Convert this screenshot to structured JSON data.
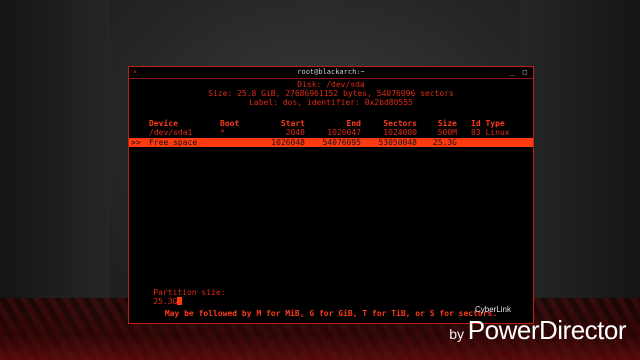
{
  "window": {
    "title": "root@blackarch:~",
    "close_glyph": "×",
    "controls": "_ □"
  },
  "disk": {
    "title": "Disk: /dev/sda",
    "size_line": "Size: 25.8 GiB, 27686961152 bytes, 54076096 sectors",
    "label_line": "Label: dos, identifier: 0x2bd80555"
  },
  "table": {
    "headers": [
      "Device",
      "Boot",
      "Start",
      "End",
      "Sectors",
      "Size",
      "Id Type"
    ],
    "rows": [
      {
        "marker": "",
        "device": "/dev/sda1",
        "boot": "*",
        "start": "2048",
        "end": "1026047",
        "sectors": "1024000",
        "size": "500M",
        "id_type": "83 Linux"
      },
      {
        "marker": ">>",
        "device": "Free space",
        "boot": "",
        "start": "1026048",
        "end": "54076095",
        "sectors": "53050048",
        "size": "25.3G",
        "id_type": ""
      }
    ]
  },
  "prompt": {
    "label": "Partition size:",
    "value": "25.3G"
  },
  "hint": "May be followed by M for MiB, G for GiB, T for TiB, or S for sectors.",
  "watermark": {
    "by": "by",
    "main": "PowerDirector",
    "small": "CyberLink"
  },
  "colors": {
    "accent": "#e02a14",
    "highlight": "#ff3a10",
    "terminal_bg": "#000000"
  }
}
